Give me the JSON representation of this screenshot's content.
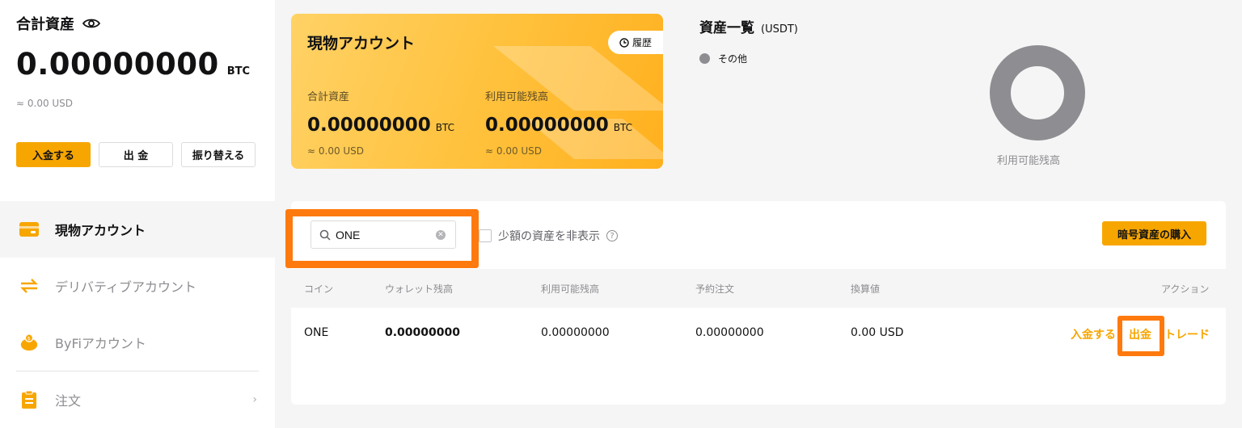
{
  "sidebar": {
    "total_title": "合計資産",
    "total_amount": "0.00000000",
    "total_unit": "BTC",
    "total_usd": "≈ 0.00 USD",
    "buttons": {
      "deposit": "入金する",
      "withdraw": "出 金",
      "transfer": "振り替える"
    },
    "nav": [
      {
        "label": "現物アカウント"
      },
      {
        "label": "デリバティブアカウント"
      },
      {
        "label": "ByFiアカウント"
      },
      {
        "label": "注文"
      }
    ]
  },
  "spot_card": {
    "title": "現物アカウント",
    "history": "履歴",
    "total_label": "合計資産",
    "total_amount": "0.00000000",
    "total_unit": "BTC",
    "total_usd": "≈ 0.00 USD",
    "available_label": "利用可能残高",
    "available_amount": "0.00000000",
    "available_unit": "BTC",
    "available_usd": "≈ 0.00 USD"
  },
  "overview": {
    "title": "資産一覧",
    "unit": "(USDT)",
    "legend": "その他",
    "donut_label": "利用可能残高",
    "legend_color": "#8d8d92"
  },
  "filters": {
    "search_value": "ONE",
    "hide_small": "少額の資産を非表示",
    "buy_button": "暗号資産の購入"
  },
  "table": {
    "headers": [
      "コイン",
      "ウォレット残高",
      "利用可能残高",
      "予約注文",
      "換算値",
      "アクション"
    ],
    "rows": [
      {
        "coin": "ONE",
        "wallet": "0.00000000",
        "available": "0.00000000",
        "reserved": "0.00000000",
        "value": "0.00 USD",
        "actions": {
          "deposit": "入金する",
          "withdraw": "出金",
          "trade": "トレード"
        }
      }
    ]
  },
  "colors": {
    "accent": "#f7a600",
    "highlight": "#ff7a0e"
  }
}
